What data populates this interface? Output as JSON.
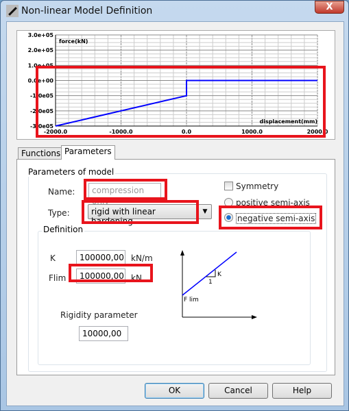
{
  "window": {
    "title": "Non-linear Model Definition",
    "close_label": "X"
  },
  "chart_data": {
    "type": "line",
    "xlabel": "displacement(mm)",
    "ylabel": "force(kN)",
    "xlim": [
      -2000,
      2000
    ],
    "ylim": [
      -300000,
      300000
    ],
    "x_ticks": [
      "-2000.0",
      "-1000.0",
      "0.0",
      "1000.0",
      "2000.0"
    ],
    "y_ticks": [
      "3.0e+05",
      "2.0e+05",
      "1.0e+05",
      "0.0e+00",
      "-1.0e05",
      "-2.0e05",
      "-3.0e05"
    ],
    "grid": true,
    "series": [
      {
        "color": "#0000ff",
        "x": [
          -2000,
          0,
          0,
          2000
        ],
        "y": [
          -300000,
          -100000,
          0,
          0
        ]
      }
    ]
  },
  "tabs": [
    {
      "label": "Functions",
      "active": false
    },
    {
      "label": "Parameters",
      "active": true
    }
  ],
  "params": {
    "group_title": "Parameters of model",
    "name_label": "Name:",
    "name_value": "compression only",
    "type_label": "Type:",
    "type_value": "rigid with linear hardening",
    "symmetry_label": "Symmetry",
    "symmetry_checked": false,
    "positive_label": "positive semi-axis",
    "negative_label": "negative semi-axis",
    "selected_axis": "negative"
  },
  "definition": {
    "title": "Definition",
    "k_label": "K",
    "k_value": "100000,00",
    "k_unit": "kN/m",
    "flim_label": "Flim",
    "flim_value": "100000,00",
    "flim_unit": "kN",
    "rigidity_label": "Rigidity parameter",
    "rigidity_value": "10000,00",
    "diagram": {
      "k": "K",
      "one": "1",
      "flim": "F lim"
    }
  },
  "buttons": {
    "ok": "OK",
    "cancel": "Cancel",
    "help": "Help"
  }
}
